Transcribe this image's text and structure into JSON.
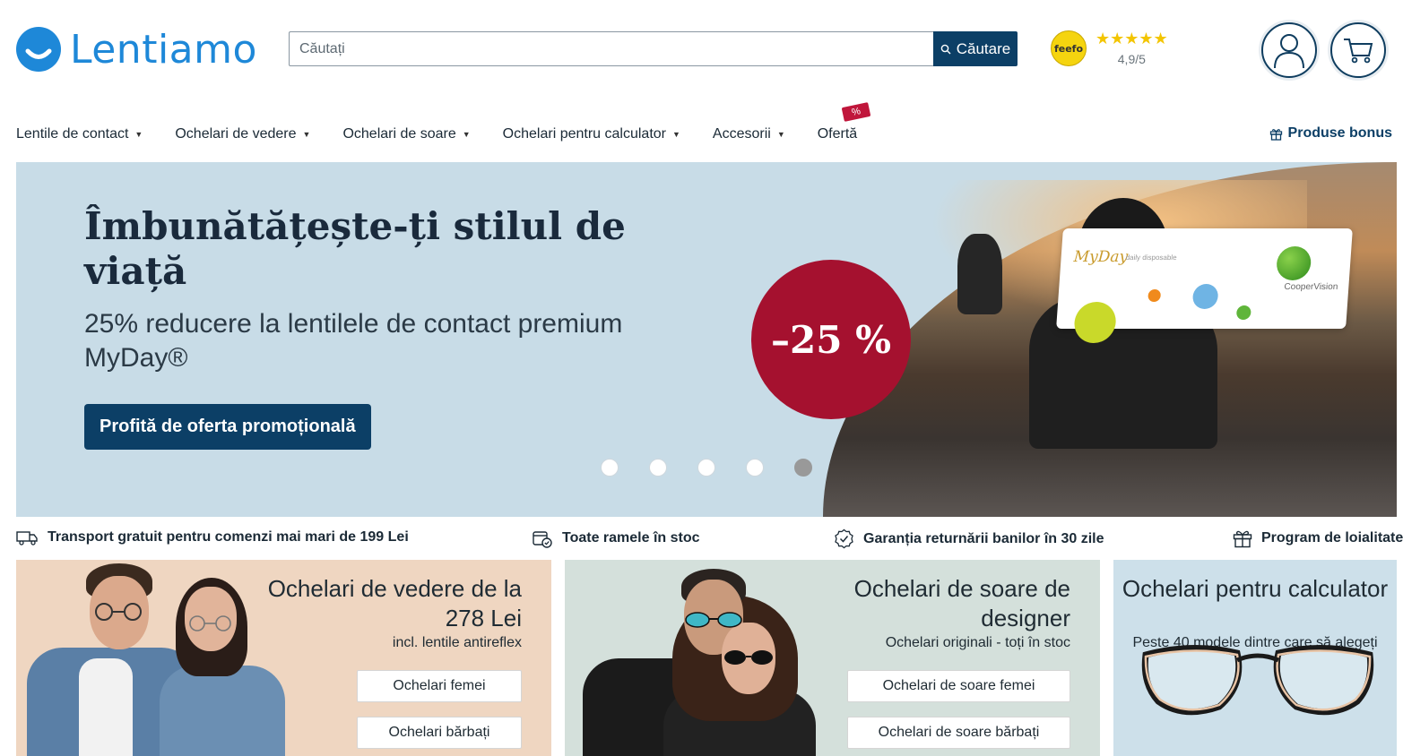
{
  "header": {
    "logo_text": "Lentiamo",
    "search_placeholder": "Căutați",
    "search_button": "Căutare",
    "feefo_badge": "feefo",
    "rating_stars": "★★★★★",
    "rating_text": "4,9/5"
  },
  "nav": {
    "items": [
      {
        "label": "Lentile de contact"
      },
      {
        "label": "Ochelari de vedere"
      },
      {
        "label": "Ochelari de soare"
      },
      {
        "label": "Ochelari pentru calculator"
      },
      {
        "label": "Accesorii"
      },
      {
        "label": "Ofertă",
        "tag": "%"
      }
    ],
    "bonus_label": "Produse bonus"
  },
  "hero": {
    "title": "Îmbunătățește-ți stilul de viață",
    "subtitle": "25% reducere la lentilele de contact premium MyDay®",
    "cta": "Profită de oferta promoțională",
    "badge": "–25 %",
    "product_brand": "MyDay",
    "product_sub": "daily disposable",
    "product_maker": "CooperVision",
    "slides_total": 5,
    "active_slide": 5
  },
  "usps": [
    {
      "icon": "truck-icon",
      "text": "Transport gratuit pentru comenzi mai mari de 199 Lei"
    },
    {
      "icon": "stock-box-icon",
      "text": "Toate ramele în stoc"
    },
    {
      "icon": "guarantee-icon",
      "text": "Garanția returnării banilor în 30 zile"
    },
    {
      "icon": "gift-icon",
      "text": "Program de loialitate"
    }
  ],
  "cards": [
    {
      "title": "Ochelari de vedere de la 278 Lei",
      "subtitle": "incl. lentile antireflex",
      "buttons": [
        "Ochelari femei",
        "Ochelari bărbați"
      ]
    },
    {
      "title": "Ochelari de soare de designer",
      "subtitle": "Ochelari originali - toți în stoc",
      "buttons": [
        "Ochelari de soare femei",
        "Ochelari de soare bărbați"
      ]
    },
    {
      "title": "Ochelari pentru calculator",
      "subtitle": "Peste 40 modele dintre care să alegeți"
    }
  ],
  "colors": {
    "brand_blue": "#1e88d8",
    "navy": "#0c3f66",
    "hero_bg": "#c8dce7",
    "badge_red": "#a5112f",
    "star_yellow": "#f3c500"
  }
}
